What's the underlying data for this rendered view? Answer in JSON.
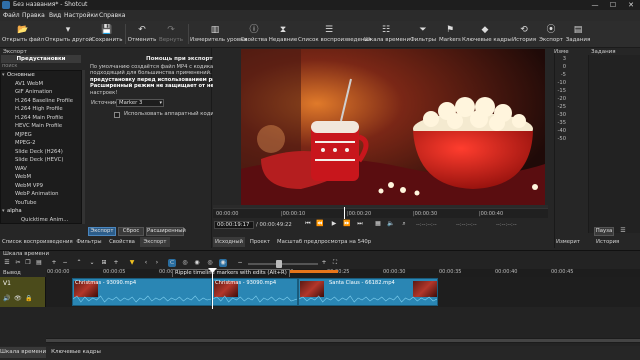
{
  "window": {
    "title": "Без названия* - Shotcut",
    "minimize": "—",
    "maximize": "☐",
    "close": "✕"
  },
  "menu": [
    "Файл",
    "Правка",
    "Вид",
    "Настройки",
    "Справка"
  ],
  "toolbar": [
    {
      "label": "Открыть файл",
      "icon": "folder-open-icon",
      "glyph": "📂"
    },
    {
      "label": "Открыть другой",
      "icon": "open-other-icon",
      "glyph": "▾"
    },
    {
      "label": "Сохранить",
      "icon": "save-icon",
      "glyph": "💾"
    },
    {
      "label": "Отменить",
      "icon": "undo-icon",
      "glyph": "↶"
    },
    {
      "label": "Вернуть",
      "icon": "redo-icon",
      "glyph": "↷"
    },
    {
      "label": "Измеритель уровня",
      "icon": "audio-meter-icon",
      "glyph": "▥"
    },
    {
      "label": "Свойства",
      "icon": "properties-icon",
      "glyph": "ⓘ"
    },
    {
      "label": "Недавние",
      "icon": "recent-icon",
      "glyph": "⧗"
    },
    {
      "label": "Список воспроизведения",
      "icon": "playlist-icon",
      "glyph": "☰"
    },
    {
      "label": "Шкала времени",
      "icon": "timeline-icon",
      "glyph": "☷"
    },
    {
      "label": "Фильтры",
      "icon": "filter-icon",
      "glyph": "⏷"
    },
    {
      "label": "Markers",
      "icon": "markers-icon",
      "glyph": "⚑"
    },
    {
      "label": "Ключевые кадры",
      "icon": "keyframes-icon",
      "glyph": "◆"
    },
    {
      "label": "История",
      "icon": "history-icon",
      "glyph": "⟲"
    },
    {
      "label": "Экспорт",
      "icon": "export-icon",
      "glyph": "⦿"
    },
    {
      "label": "Задания",
      "icon": "jobs-icon",
      "glyph": "▤"
    }
  ],
  "export_panel": {
    "title": "Экспорт",
    "presets_tab": "Предустановки",
    "search_placeholder": "поиск",
    "presets": [
      {
        "label": "Основные",
        "kind": "cat",
        "expanded": true
      },
      {
        "label": "AV1 WebM"
      },
      {
        "label": "GIF Animation"
      },
      {
        "label": "H.264 Baseline Profile"
      },
      {
        "label": "H.264 High Profile"
      },
      {
        "label": "H.264 Main Profile"
      },
      {
        "label": "HEVC Main Profile"
      },
      {
        "label": "MJPEG"
      },
      {
        "label": "MPEG-2"
      },
      {
        "label": "Slide Deck (H264)"
      },
      {
        "label": "Slide Deck (HEVC)"
      },
      {
        "label": "WAV"
      },
      {
        "label": "WebM"
      },
      {
        "label": "WebM VP9"
      },
      {
        "label": "WebP Animation"
      },
      {
        "label": "YouTube"
      },
      {
        "label": "alpha",
        "kind": "cat",
        "expanded": true
      },
      {
        "label": "Quicktime Anim...",
        "indent": true
      }
    ],
    "help_title": "Помощь при экспорте",
    "help_lines": [
      "По умолчанию создаётся файл MP4 с кодиками",
      "подходящий для большинства применений. Вы",
      "предустановку перед использованием расши",
      "Расширенный режим не защищает от неверн",
      "настроек!"
    ],
    "source_label": "Источник:",
    "source_value": "Marker 3",
    "hw_encoder_label": "Использовать аппаратный кодир",
    "buttons": [
      "Экспорт",
      "Сброс",
      "Расширенный"
    ]
  },
  "left_tabs": [
    "Список воспроизведения",
    "Фильтры",
    "Свойства",
    "Экспорт"
  ],
  "player": {
    "ruler": [
      "00:00:00",
      "|00:00:10",
      "|00:00:20",
      "|00:00:30",
      "|00:00:40"
    ],
    "current_time": "00:00:19:17",
    "total_time": "/ 00:00:49:22",
    "inout": "--:--:--:--",
    "tabs": [
      "Исходный",
      "Проект",
      "Масштаб предпросмотра на 540p"
    ]
  },
  "meter": {
    "levels": [
      "3",
      "0",
      "-5",
      "-10",
      "-15",
      "-20",
      "-25",
      "-30",
      "-35",
      "-40",
      "-50"
    ],
    "title": "Изме"
  },
  "jobs": {
    "title": "Задания",
    "pause": "Пауза",
    "tabs": [
      "Измерит",
      "История"
    ]
  },
  "timeline": {
    "title": "Шкала времени",
    "output_label": "Вывод",
    "track": "V1",
    "ruler": [
      "00:00:00",
      "00:00:05",
      "00:00:10",
      "00:00:15",
      "00:00:20",
      "00:00:25",
      "00:00:30",
      "00:00:35",
      "00:00:40",
      "00:00:45"
    ],
    "tooltip": "Ripple timeline markers with edits (Alt+R)",
    "clips": [
      {
        "name": "Christmas - 93090.mp4"
      },
      {
        "name": "Christmas - 93090.mp4"
      },
      {
        "name": "Santa Claus - 66182.mp4"
      }
    ]
  },
  "bottom_tabs": [
    "Шкала времени",
    "Ключевые кадры"
  ],
  "colors": {
    "accent": "#2a86b4",
    "track_head": "#4b4b1b",
    "marker": "#e8751a"
  }
}
